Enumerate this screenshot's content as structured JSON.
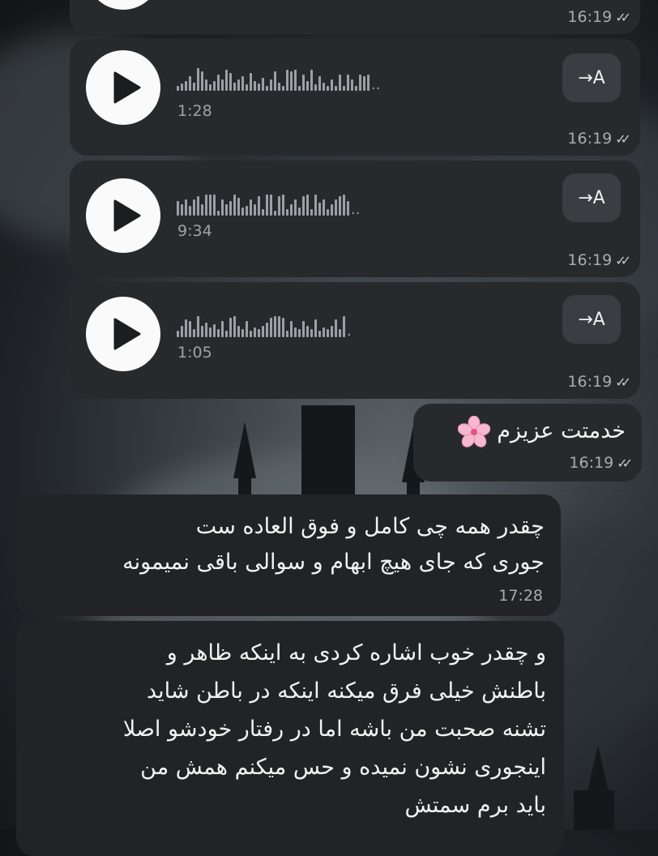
{
  "messages": {
    "voice1": {
      "time": "16:19"
    },
    "voice2": {
      "duration": "1:28",
      "translate_label": "→A",
      "time": "16:19"
    },
    "voice3": {
      "duration": "9:34",
      "translate_label": "→A",
      "time": "16:19"
    },
    "voice4": {
      "duration": "1:05",
      "translate_label": "→A",
      "time": "16:19"
    },
    "text_out": {
      "text": "خدمتت عزیزم",
      "emoji": "cherry-blossom",
      "time": "16:19"
    },
    "text_in1": {
      "lines": [
        "چقدر همه چی کامل و فوق العاده ست",
        "جوری که جای هیچ ابهام و سوالی باقی نمیمونه"
      ],
      "time": "17:28"
    },
    "text_in2": {
      "lines": [
        "و چقدر خوب اشاره کردی به اینکه ظاهر و",
        "باطنش خیلی فرق میکنه اینکه در باطن شاید",
        "تشنه صحبت من باشه اما در رفتار خودشو اصلا",
        "اینجوری نشون نمیده و حس میکنم همش من",
        "باید برم سمتش"
      ]
    }
  },
  "icons": {
    "play": "play-icon",
    "read_receipt": "double-check-icon"
  },
  "colors": {
    "bubble_out": "#272a2d",
    "bubble_in": "#212326",
    "play_button": "#fafafa"
  }
}
